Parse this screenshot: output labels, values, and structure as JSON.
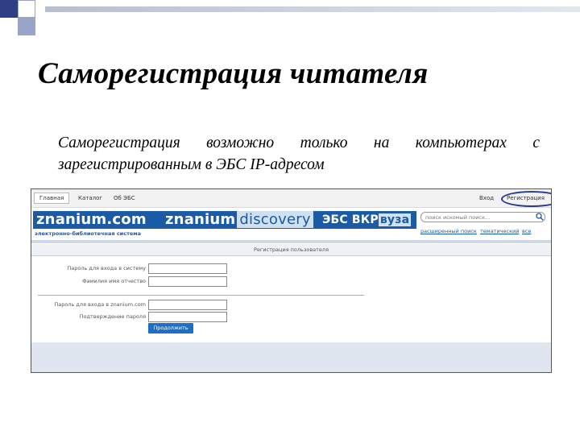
{
  "slide": {
    "title": "Саморегистрация читателя",
    "body": "Саморегистрация возможно только на компьютерах с зарегистрированным в ЭБС IP-адресом"
  },
  "screenshot": {
    "nav": {
      "home": "Главная",
      "catalog": "Каталог",
      "about": "Об ЭБС",
      "login": "Вход",
      "register": "Регистрация"
    },
    "logos": {
      "znanium": "znanium.com",
      "discovery_main": "znanium",
      "discovery_suffix": "discovery",
      "vkr_main": "ЭБС ВКР",
      "vkr_suffix": "вуза"
    },
    "tagline": "электронно-библиотечная система",
    "search": {
      "placeholder": "поиск искомый поиск..."
    },
    "links": {
      "link1": "расширенный поиск",
      "link2": "тематический",
      "link3": "все"
    },
    "form": {
      "header": "Регистрация пользователя",
      "field1_label": "Пароль для входа в систему",
      "field2_label": "Фамилия имя отчество",
      "field3_label": "Пароль для входа в znanium.com",
      "field4_label": "Подтверждение пароля",
      "submit": "Продолжить"
    },
    "colors": {
      "brand": "#1b5aa5",
      "highlight": "#2a3a8c"
    }
  }
}
